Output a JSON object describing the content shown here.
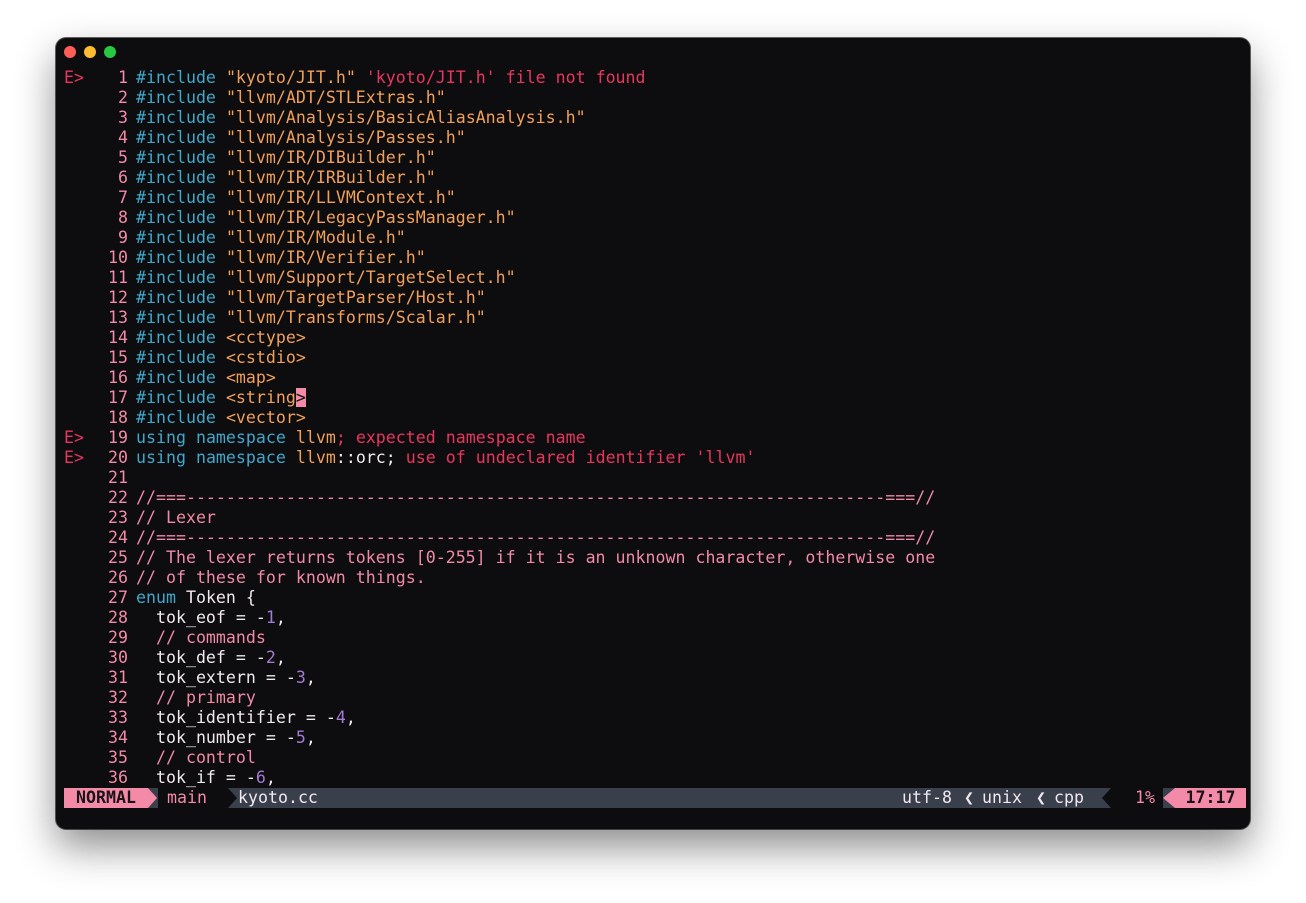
{
  "colors": {
    "background": "#0d0c0e",
    "keyword": "#3fa9cc",
    "string": "#f0a05a",
    "error": "#e8375f",
    "comment": "#f08aa6",
    "number": "#a37ad6",
    "accent": "#f38ba8"
  },
  "editor": {
    "lines": [
      {
        "sign": "E>",
        "num": "1",
        "tokens": [
          [
            "kw",
            "#include"
          ],
          [
            "plain",
            " "
          ],
          [
            "str",
            "\"kyoto/JIT.h\""
          ],
          [
            "err",
            " 'kyoto/JIT.h' file not found"
          ]
        ]
      },
      {
        "sign": "",
        "num": "2",
        "tokens": [
          [
            "kw",
            "#include"
          ],
          [
            "plain",
            " "
          ],
          [
            "str",
            "\"llvm/ADT/STLExtras.h\""
          ]
        ]
      },
      {
        "sign": "",
        "num": "3",
        "tokens": [
          [
            "kw",
            "#include"
          ],
          [
            "plain",
            " "
          ],
          [
            "str",
            "\"llvm/Analysis/BasicAliasAnalysis.h\""
          ]
        ]
      },
      {
        "sign": "",
        "num": "4",
        "tokens": [
          [
            "kw",
            "#include"
          ],
          [
            "plain",
            " "
          ],
          [
            "str",
            "\"llvm/Analysis/Passes.h\""
          ]
        ]
      },
      {
        "sign": "",
        "num": "5",
        "tokens": [
          [
            "kw",
            "#include"
          ],
          [
            "plain",
            " "
          ],
          [
            "str",
            "\"llvm/IR/DIBuilder.h\""
          ]
        ]
      },
      {
        "sign": "",
        "num": "6",
        "tokens": [
          [
            "kw",
            "#include"
          ],
          [
            "plain",
            " "
          ],
          [
            "str",
            "\"llvm/IR/IRBuilder.h\""
          ]
        ]
      },
      {
        "sign": "",
        "num": "7",
        "tokens": [
          [
            "kw",
            "#include"
          ],
          [
            "plain",
            " "
          ],
          [
            "str",
            "\"llvm/IR/LLVMContext.h\""
          ]
        ]
      },
      {
        "sign": "",
        "num": "8",
        "tokens": [
          [
            "kw",
            "#include"
          ],
          [
            "plain",
            " "
          ],
          [
            "str",
            "\"llvm/IR/LegacyPassManager.h\""
          ]
        ]
      },
      {
        "sign": "",
        "num": "9",
        "tokens": [
          [
            "kw",
            "#include"
          ],
          [
            "plain",
            " "
          ],
          [
            "str",
            "\"llvm/IR/Module.h\""
          ]
        ]
      },
      {
        "sign": "",
        "num": "10",
        "tokens": [
          [
            "kw",
            "#include"
          ],
          [
            "plain",
            " "
          ],
          [
            "str",
            "\"llvm/IR/Verifier.h\""
          ]
        ]
      },
      {
        "sign": "",
        "num": "11",
        "tokens": [
          [
            "kw",
            "#include"
          ],
          [
            "plain",
            " "
          ],
          [
            "str",
            "\"llvm/Support/TargetSelect.h\""
          ]
        ]
      },
      {
        "sign": "",
        "num": "12",
        "tokens": [
          [
            "kw",
            "#include"
          ],
          [
            "plain",
            " "
          ],
          [
            "str",
            "\"llvm/TargetParser/Host.h\""
          ]
        ]
      },
      {
        "sign": "",
        "num": "13",
        "tokens": [
          [
            "kw",
            "#include"
          ],
          [
            "plain",
            " "
          ],
          [
            "str",
            "\"llvm/Transforms/Scalar.h\""
          ]
        ]
      },
      {
        "sign": "",
        "num": "14",
        "tokens": [
          [
            "kw",
            "#include"
          ],
          [
            "plain",
            " "
          ],
          [
            "str",
            "<cctype>"
          ]
        ]
      },
      {
        "sign": "",
        "num": "15",
        "tokens": [
          [
            "kw",
            "#include"
          ],
          [
            "plain",
            " "
          ],
          [
            "str",
            "<cstdio>"
          ]
        ]
      },
      {
        "sign": "",
        "num": "16",
        "tokens": [
          [
            "kw",
            "#include"
          ],
          [
            "plain",
            " "
          ],
          [
            "str",
            "<map>"
          ]
        ]
      },
      {
        "sign": "",
        "num": "17",
        "tokens": [
          [
            "kw",
            "#include"
          ],
          [
            "plain",
            " "
          ],
          [
            "str",
            "<string"
          ],
          [
            "cursor",
            ">"
          ]
        ]
      },
      {
        "sign": "",
        "num": "18",
        "tokens": [
          [
            "kw",
            "#include"
          ],
          [
            "plain",
            " "
          ],
          [
            "str",
            "<vector>"
          ]
        ]
      },
      {
        "sign": "E>",
        "num": "19",
        "tokens": [
          [
            "kw",
            "using"
          ],
          [
            "plain",
            " "
          ],
          [
            "kw",
            "namespace"
          ],
          [
            "plain",
            " "
          ],
          [
            "ns",
            "llvm"
          ],
          [
            "err",
            "; expected namespace name"
          ]
        ]
      },
      {
        "sign": "E>",
        "num": "20",
        "tokens": [
          [
            "kw",
            "using"
          ],
          [
            "plain",
            " "
          ],
          [
            "kw",
            "namespace"
          ],
          [
            "plain",
            " "
          ],
          [
            "ns",
            "llvm"
          ],
          [
            "plain",
            "::orc;"
          ],
          [
            "err",
            " use of undeclared identifier 'llvm'"
          ]
        ]
      },
      {
        "sign": "",
        "num": "21",
        "tokens": []
      },
      {
        "sign": "",
        "num": "22",
        "tokens": [
          [
            "cmt",
            "//===----------------------------------------------------------------------===//"
          ]
        ]
      },
      {
        "sign": "",
        "num": "23",
        "tokens": [
          [
            "cmt",
            "// Lexer"
          ]
        ]
      },
      {
        "sign": "",
        "num": "24",
        "tokens": [
          [
            "cmt",
            "//===----------------------------------------------------------------------===//"
          ]
        ]
      },
      {
        "sign": "",
        "num": "25",
        "tokens": [
          [
            "cmt",
            "// The lexer returns tokens [0-255] if it is an unknown character, otherwise one"
          ]
        ]
      },
      {
        "sign": "",
        "num": "26",
        "tokens": [
          [
            "cmt",
            "// of these for known things."
          ]
        ]
      },
      {
        "sign": "",
        "num": "27",
        "tokens": [
          [
            "kw",
            "enum"
          ],
          [
            "plain",
            " Token {"
          ]
        ]
      },
      {
        "sign": "",
        "num": "28",
        "tokens": [
          [
            "plain",
            "  tok_eof = -"
          ],
          [
            "numlit",
            "1"
          ],
          [
            "plain",
            ","
          ]
        ]
      },
      {
        "sign": "",
        "num": "29",
        "tokens": [
          [
            "cmt",
            "  // commands"
          ]
        ]
      },
      {
        "sign": "",
        "num": "30",
        "tokens": [
          [
            "plain",
            "  tok_def = -"
          ],
          [
            "numlit",
            "2"
          ],
          [
            "plain",
            ","
          ]
        ]
      },
      {
        "sign": "",
        "num": "31",
        "tokens": [
          [
            "plain",
            "  tok_extern = -"
          ],
          [
            "numlit",
            "3"
          ],
          [
            "plain",
            ","
          ]
        ]
      },
      {
        "sign": "",
        "num": "32",
        "tokens": [
          [
            "cmt",
            "  // primary"
          ]
        ]
      },
      {
        "sign": "",
        "num": "33",
        "tokens": [
          [
            "plain",
            "  tok_identifier = -"
          ],
          [
            "numlit",
            "4"
          ],
          [
            "plain",
            ","
          ]
        ]
      },
      {
        "sign": "",
        "num": "34",
        "tokens": [
          [
            "plain",
            "  tok_number = -"
          ],
          [
            "numlit",
            "5"
          ],
          [
            "plain",
            ","
          ]
        ]
      },
      {
        "sign": "",
        "num": "35",
        "tokens": [
          [
            "cmt",
            "  // control"
          ]
        ]
      },
      {
        "sign": "",
        "num": "36",
        "tokens": [
          [
            "plain",
            "  tok_if = -"
          ],
          [
            "numlit",
            "6"
          ],
          [
            "plain",
            ","
          ]
        ]
      }
    ]
  },
  "statusline": {
    "mode": "NORMAL",
    "branch": "main",
    "filename": "kyoto.cc",
    "encoding": "utf-8",
    "fileformat": "unix",
    "filetype": "cpp",
    "percent": "1%",
    "position": "17:17",
    "separator": "❮"
  }
}
